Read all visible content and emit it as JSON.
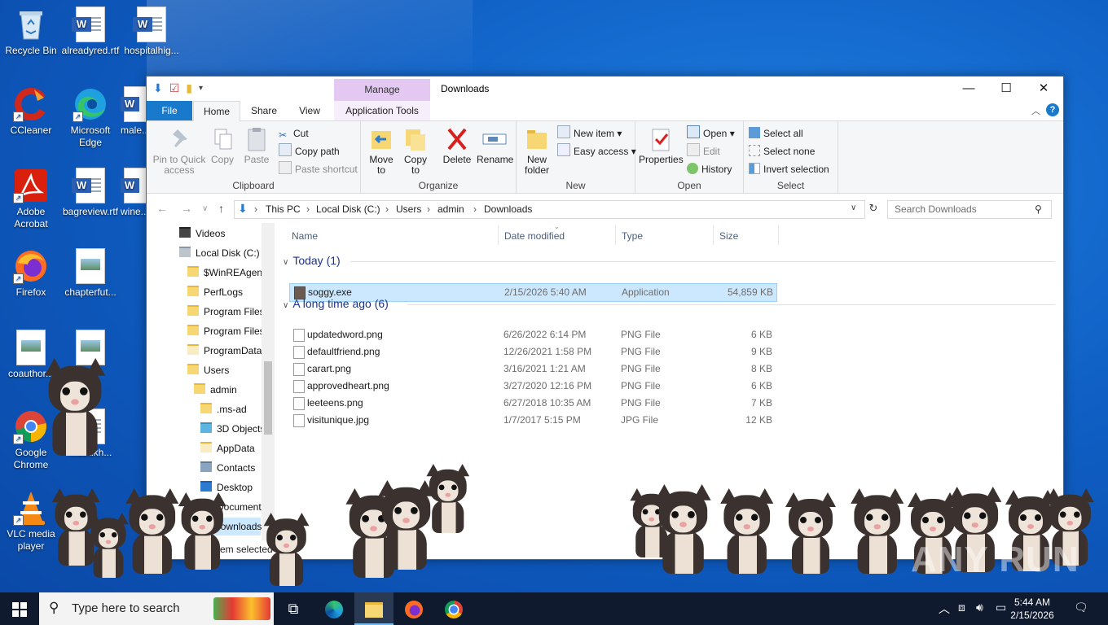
{
  "desktop": {
    "icons": [
      {
        "label": "Recycle Bin"
      },
      {
        "label": "alreadyred.rtf"
      },
      {
        "label": "hospitalhig..."
      },
      {
        "label": "CCleaner"
      },
      {
        "label": "Microsoft Edge"
      },
      {
        "label": "male..."
      },
      {
        "label": "Adobe Acrobat"
      },
      {
        "label": "bagreview.rtf"
      },
      {
        "label": "wine..."
      },
      {
        "label": "Firefox"
      },
      {
        "label": "chapterfut..."
      },
      {
        "label": "coauthor..."
      },
      {
        "label": "Google Chrome"
      },
      {
        "label": "...ubukh..."
      },
      {
        "label": "VLC media player"
      }
    ]
  },
  "explorer": {
    "title": "Downloads",
    "context_tab": "Manage",
    "tabs": [
      "File",
      "Home",
      "Share",
      "View",
      "Application Tools"
    ],
    "ribbon": {
      "clipboard": {
        "label": "Clipboard",
        "pin": "Pin to Quick access",
        "copy": "Copy",
        "paste": "Paste",
        "cut": "Cut",
        "copy_path": "Copy path",
        "paste_shortcut": "Paste shortcut"
      },
      "organize": {
        "label": "Organize",
        "move_to": "Move to",
        "copy_to": "Copy to",
        "delete": "Delete",
        "rename": "Rename"
      },
      "new": {
        "label": "New",
        "new_folder": "New folder",
        "new_item": "New item",
        "easy_access": "Easy access"
      },
      "open": {
        "label": "Open",
        "properties": "Properties",
        "open": "Open",
        "edit": "Edit",
        "history": "History"
      },
      "select": {
        "label": "Select",
        "select_all": "Select all",
        "select_none": "Select none",
        "invert": "Invert selection"
      }
    },
    "breadcrumb": [
      "This PC",
      "Local Disk (C:)",
      "Users",
      "admin",
      "Downloads"
    ],
    "search_placeholder": "Search Downloads",
    "nav": [
      {
        "label": "Videos"
      },
      {
        "label": "Local Disk (C:)"
      },
      {
        "label": "$WinREAgent"
      },
      {
        "label": "PerfLogs"
      },
      {
        "label": "Program Files"
      },
      {
        "label": "Program Files"
      },
      {
        "label": "ProgramData"
      },
      {
        "label": "Users"
      },
      {
        "label": "admin"
      },
      {
        "label": ".ms-ad"
      },
      {
        "label": "3D Objects"
      },
      {
        "label": "AppData"
      },
      {
        "label": "Contacts"
      },
      {
        "label": "Desktop"
      },
      {
        "label": "Documents"
      },
      {
        "label": "Downloads"
      }
    ],
    "columns": [
      "Name",
      "Date modified",
      "Type",
      "Size"
    ],
    "groups": [
      {
        "title": "Today (1)",
        "files": [
          {
            "name": "soggy.exe",
            "date": "2/15/2026 5:40 AM",
            "type": "Application",
            "size": "54,859 KB"
          }
        ]
      },
      {
        "title": "A long time ago (6)",
        "files": [
          {
            "name": "updatedword.png",
            "date": "6/26/2022 6:14 PM",
            "type": "PNG File",
            "size": "6 KB"
          },
          {
            "name": "defaultfriend.png",
            "date": "12/26/2021 1:58 PM",
            "type": "PNG File",
            "size": "9 KB"
          },
          {
            "name": "carart.png",
            "date": "3/16/2021 1:21 AM",
            "type": "PNG File",
            "size": "8 KB"
          },
          {
            "name": "approvedheart.png",
            "date": "3/27/2020 12:16 PM",
            "type": "PNG File",
            "size": "6 KB"
          },
          {
            "name": "leeteens.png",
            "date": "6/27/2018 10:35 AM",
            "type": "PNG File",
            "size": "7 KB"
          },
          {
            "name": "visitunique.jpg",
            "date": "1/7/2017 5:15 PM",
            "type": "JPG File",
            "size": "12 KB"
          }
        ]
      }
    ],
    "status": "1 item selected"
  },
  "taskbar": {
    "search_placeholder": "Type here to search",
    "time": "5:44 AM",
    "date": "2/15/2026"
  },
  "watermark": "ANY RUN"
}
